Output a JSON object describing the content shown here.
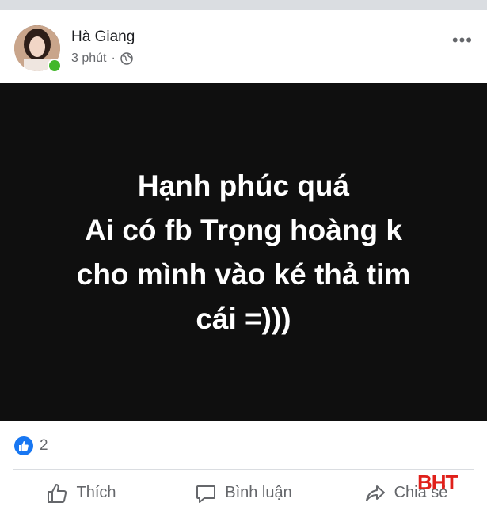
{
  "post": {
    "author_name": "Hà Giang",
    "timestamp": "3 phút",
    "separator": "·",
    "privacy_icon": "globe-icon",
    "more_icon": "more-options-icon",
    "online_status_color": "#42b72a",
    "text_lines": [
      "Hạnh phúc quá",
      "Ai có fb Trọng hoàng k",
      "cho mình vào ké thả tim",
      "cái =)))"
    ],
    "background_color": "#0f0f0f",
    "reaction_icon": "like-icon",
    "reaction_count": "2"
  },
  "actions": {
    "like_label": "Thích",
    "comment_label": "Bình luận",
    "share_label": "Chia sẻ"
  },
  "watermark": {
    "text": "BHT",
    "color": "#e0201a"
  }
}
